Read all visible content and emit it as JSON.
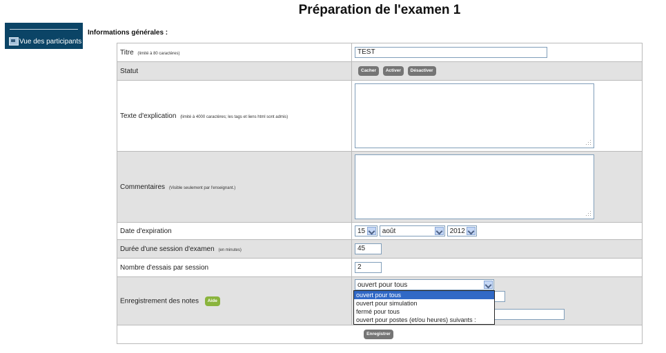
{
  "page_title": "Préparation de l'examen 1",
  "sidebar": {
    "button_label": "Vue des participants",
    "icon": "participants-icon"
  },
  "section_title": "Informations générales  :",
  "form": {
    "titre": {
      "label": "Titre",
      "hint": "(limité à 80 caractères)",
      "value": "TEST"
    },
    "statut": {
      "label": "Statut",
      "buttons": [
        "Cacher",
        "Activer",
        "Désactiver"
      ]
    },
    "texte": {
      "label": "Texte d'explication",
      "hint": "(limité à 4000 caractères; les tags et liens html sont admis)",
      "value": ""
    },
    "commentaires": {
      "label": "Commentaires",
      "hint": "(Visible seulement par l'enseignant.)",
      "value": ""
    },
    "date": {
      "label": "Date d'expiration",
      "day": "15",
      "month": "août",
      "year": "2012"
    },
    "duree": {
      "label": "Durée d'une session d'examen",
      "hint": "(en minutes)",
      "value": "45"
    },
    "essais": {
      "label": "Nombre d'essais par session",
      "value": "2"
    },
    "notes": {
      "label": "Enregistrement des notes",
      "aide": "Aide",
      "selected": "ouvert pour tous",
      "options": [
        "ouvert pour tous",
        "ouvert pour simulation",
        "fermé pour tous",
        "ouvert pour postes (et/ou heures) suivants :"
      ]
    },
    "submit": "Enregistrer"
  }
}
